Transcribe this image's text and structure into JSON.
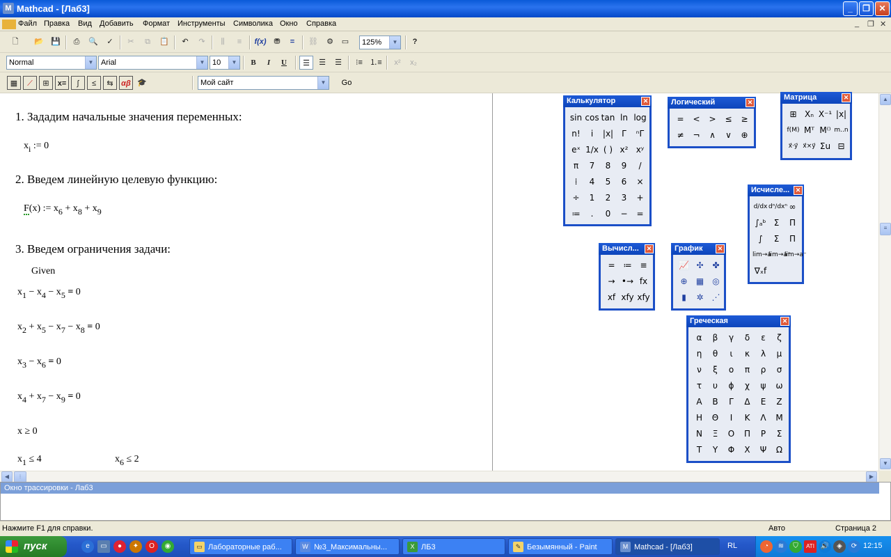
{
  "window": {
    "title": "Mathcad - [Лаб3]",
    "app_icon": "M",
    "min": "_",
    "max": "❐",
    "close": "✕"
  },
  "menu": [
    "Файл",
    "Правка",
    "Вид",
    "Добавить",
    "Формат",
    "Инструменты",
    "Символика",
    "Окно",
    "Справка"
  ],
  "mdi": {
    "min": "_",
    "restore": "❐",
    "close": "✕"
  },
  "toolbar": {
    "zoom": "125%",
    "style": "Normal",
    "font": "Arial",
    "size": "10",
    "bold": "B",
    "italic": "I",
    "underline": "U",
    "resource": "Мой сайт",
    "go": "Go"
  },
  "doc": {
    "h1": "1. Зададим начальные значения переменных:",
    "h2": "2. Введем линейную целевую функцию:",
    "h3": "3. Введем ограничения задачи:",
    "given": "Given",
    "eq_xi": {
      "a": "x",
      "sub": "i",
      "rest": " := 0"
    },
    "eq_F": {
      "f": "F",
      "rest": "(x) := x",
      "s1": "6",
      "p1": " + x",
      "s2": "8",
      "p2": " + x",
      "s3": "9"
    },
    "c1": {
      "x1": "x",
      "s1": "1",
      "op1": " − x",
      "s2": "4",
      "op2": " − x",
      "s3": "5",
      "eq": " =",
      "rhs": " 0"
    },
    "c2": {
      "x1": "x",
      "s1": "2",
      "op1": " + x",
      "s2": "5",
      "op2": " − x",
      "s3": "7",
      "op3": " − x",
      "s4": "8",
      "eq": " =",
      "rhs": " 0"
    },
    "c3": {
      "x1": "x",
      "s1": "3",
      "op1": " − x",
      "s2": "6",
      "eq": " =",
      "rhs": " 0"
    },
    "c4": {
      "x1": "x",
      "s1": "4",
      "op1": " + x",
      "s2": "7",
      "op2": " − x",
      "s3": "9",
      "eq": " =",
      "rhs": " 0"
    },
    "c5": "x ≥ 0",
    "c6a": {
      "x": "x",
      "s": "1",
      "rest": " ≤ 4"
    },
    "c6b": {
      "x": "x",
      "s": "6",
      "rest": " ≤ 2"
    }
  },
  "palettes": {
    "calc": {
      "title": "Калькулятор",
      "cells": [
        "sin",
        "cos",
        "tan",
        "ln",
        "log",
        "n!",
        "i",
        "|x|",
        "Γ",
        "ⁿΓ",
        "eˣ",
        "1/x",
        "( )",
        "x²",
        "xʸ",
        "π",
        "7",
        "8",
        "9",
        "/",
        "⁞",
        "4",
        "5",
        "6",
        "×",
        "÷",
        "1",
        "2",
        "3",
        "+",
        "≔",
        ".",
        "0",
        "−",
        "="
      ]
    },
    "logic": {
      "title": "Логический",
      "cells": [
        "=",
        "<",
        ">",
        "≤",
        "≥",
        "≠",
        "¬",
        "∧",
        "∨",
        "⊕"
      ]
    },
    "matrix": {
      "title": "Матрица",
      "cells": [
        "⊞",
        "Xₙ",
        "X⁻¹",
        "|x|",
        "f(M)",
        "Mᵀ",
        "M⁽⁾",
        "m..n",
        "x⃗·y⃗",
        "x⃗×y⃗",
        "Σu",
        "⊟"
      ]
    },
    "calculus": {
      "title": "Исчисле...",
      "cells": [
        "d/dx",
        "dⁿ/dxⁿ",
        "∞",
        "∫ₐᵇ",
        "Σ",
        "Π",
        "∫",
        "Σ",
        "Π",
        "lim→a",
        "lim→a⁺",
        "lim→a⁻",
        "∇ₓf"
      ]
    },
    "evaluation": {
      "title": "Вычисл...",
      "cells": [
        "=",
        "≔",
        "≡",
        "→",
        "•→",
        "fx",
        "xf",
        "xfy",
        "xfy"
      ]
    },
    "graph": {
      "title": "График",
      "cells": [
        "📈",
        "✣",
        "✤",
        "⊕",
        "▦",
        "◎",
        "▮",
        "✲",
        "⋰"
      ]
    },
    "greek": {
      "title": "Греческая",
      "cells": [
        "α",
        "β",
        "γ",
        "δ",
        "ε",
        "ζ",
        "η",
        "θ",
        "ι",
        "κ",
        "λ",
        "μ",
        "ν",
        "ξ",
        "ο",
        "π",
        "ρ",
        "σ",
        "τ",
        "υ",
        "ϕ",
        "χ",
        "ψ",
        "ω",
        "Α",
        "Β",
        "Γ",
        "Δ",
        "Ε",
        "Ζ",
        "Η",
        "Θ",
        "Ι",
        "Κ",
        "Λ",
        "Μ",
        "Ν",
        "Ξ",
        "Ο",
        "Π",
        "Ρ",
        "Σ",
        "Τ",
        "Υ",
        "Φ",
        "Χ",
        "Ψ",
        "Ω"
      ]
    }
  },
  "trace_title": "Окно трассировки - Лаб3",
  "status": {
    "help": "Нажмите F1 для справки.",
    "mode": "Авто",
    "page": "Страница 2"
  },
  "taskbar": {
    "start": "пуск",
    "tasks": [
      "Лабораторные раб...",
      "№3_Максимальны...",
      "ЛБ3",
      "Безымянный - Paint",
      "Mathcad - [Лаб3]"
    ],
    "lang": "RL",
    "clock": "12:15"
  }
}
